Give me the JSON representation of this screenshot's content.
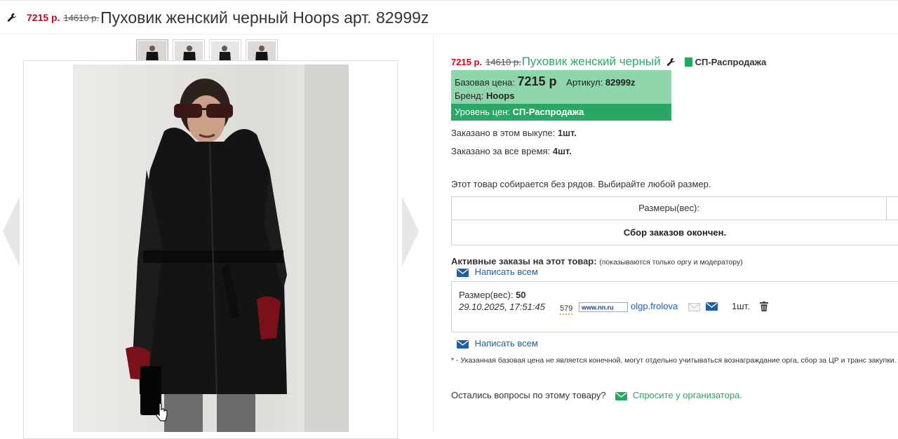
{
  "header": {
    "price": "7215 р.",
    "old_price": "14610 р.",
    "title": "Пуховик женский черный Hoops арт. 82999z"
  },
  "gallery": {
    "thumbnails": [
      "thumb-1",
      "thumb-2",
      "thumb-3",
      "thumb-4"
    ],
    "active_index": 0
  },
  "product": {
    "price": "7215 р.",
    "old_price": "14610 р.",
    "name": "Пуховик женский черный",
    "sale_tag": "СП-Распродажа",
    "base_price_label": "Базовая цена:",
    "base_price_value": "7215 р",
    "article_label": "Артикул:",
    "article_value": "82999z",
    "brand_label": "Бренд:",
    "brand_value": "Hoops",
    "level_label": "Уровень цен:",
    "level_value": "СП-Распродажа",
    "ordered_current_label": "Заказано в этом выкупе:",
    "ordered_current_value": "1шт.",
    "ordered_total_label": "Заказано за все время:",
    "ordered_total_value": "4шт.",
    "rows_note": "Этот товар собирается без рядов. Выбирайте любой размер.",
    "sizes_header": "Размеры(вес):",
    "sizes_status": "Сбор заказов окончен."
  },
  "orders": {
    "title": "Активные заказы на этот товар:",
    "hint": "(показываются только оргу и модератору)",
    "write_all_label": "Написать всем",
    "items": [
      {
        "size_label": "Размер(вес):",
        "size_value": "50",
        "datetime": "29.10.2025, 17:51:45",
        "badge": "579",
        "site_logo": "www.nn.ru",
        "user": "olgp.frolova",
        "qty": "1шт."
      }
    ],
    "write_all_label_bottom": "Написать всем"
  },
  "footer": {
    "note": "* - Указанная базовая цена не является конечной, могут отдельно учитываться вознаграждание орга, сбор за ЦР и транс закупки.",
    "question_text": "Остались вопросы по этому товару?",
    "ask_link": "Спросите у организатора."
  },
  "colors": {
    "price_red": "#d0021b",
    "green": "#2aa665",
    "light_green": "#8fd6ad",
    "link_blue": "#1f5fa8"
  }
}
